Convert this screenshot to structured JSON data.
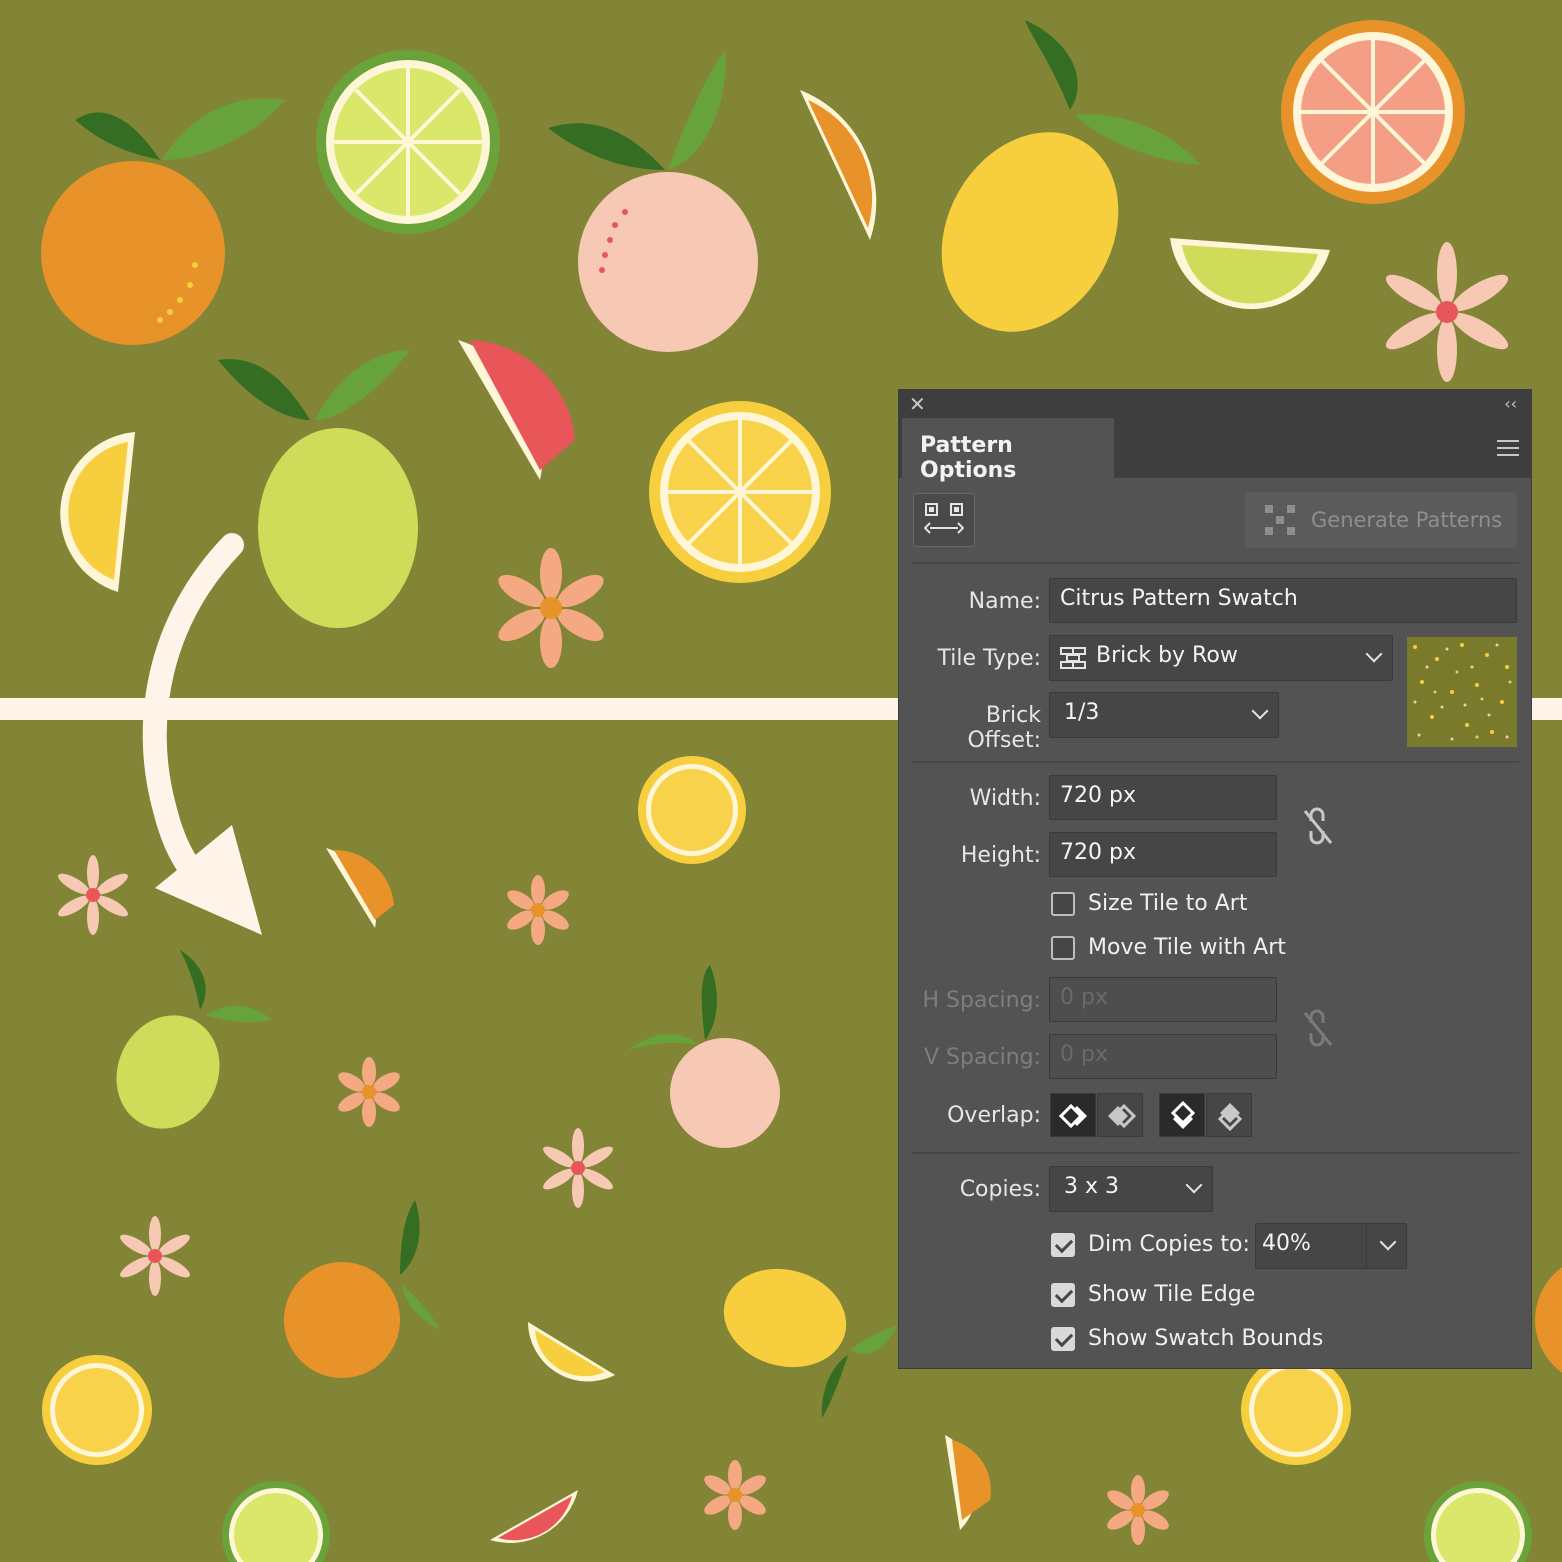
{
  "panel": {
    "title": "Pattern Options",
    "generate_button": "Generate Patterns",
    "name_label": "Name:",
    "name_value": "Citrus Pattern Swatch",
    "tile_type_label": "Tile Type:",
    "tile_type_value": "Brick by Row",
    "brick_offset_label": "Brick Offset:",
    "brick_offset_value": "1/3",
    "width_label": "Width:",
    "width_value": "720 px",
    "height_label": "Height:",
    "height_value": "720 px",
    "size_tile_to_art": "Size Tile to Art",
    "move_tile_with_art": "Move Tile with Art",
    "h_spacing_label": "H Spacing:",
    "h_spacing_value": "0 px",
    "v_spacing_label": "V Spacing:",
    "v_spacing_value": "0 px",
    "overlap_label": "Overlap:",
    "copies_label": "Copies:",
    "copies_value": "3 x 3",
    "dim_copies_label": "Dim Copies to:",
    "dim_copies_value": "40%",
    "show_tile_edge": "Show Tile Edge",
    "show_swatch_bounds": "Show Swatch Bounds",
    "checkboxes": {
      "size_tile_to_art": false,
      "move_tile_with_art": false,
      "dim_copies": true,
      "show_tile_edge": true,
      "show_swatch_bounds": true
    }
  },
  "colors": {
    "background": "#838536",
    "panel": "#535353",
    "divider": "#fff3ea",
    "orange": "#e8922a",
    "lemon": "#f7cf3e",
    "lime": "#cfdc5a",
    "grapefruit": "#f7c8b4",
    "red_grapefruit": "#e8565a",
    "leaf": "#4f8a2c"
  }
}
